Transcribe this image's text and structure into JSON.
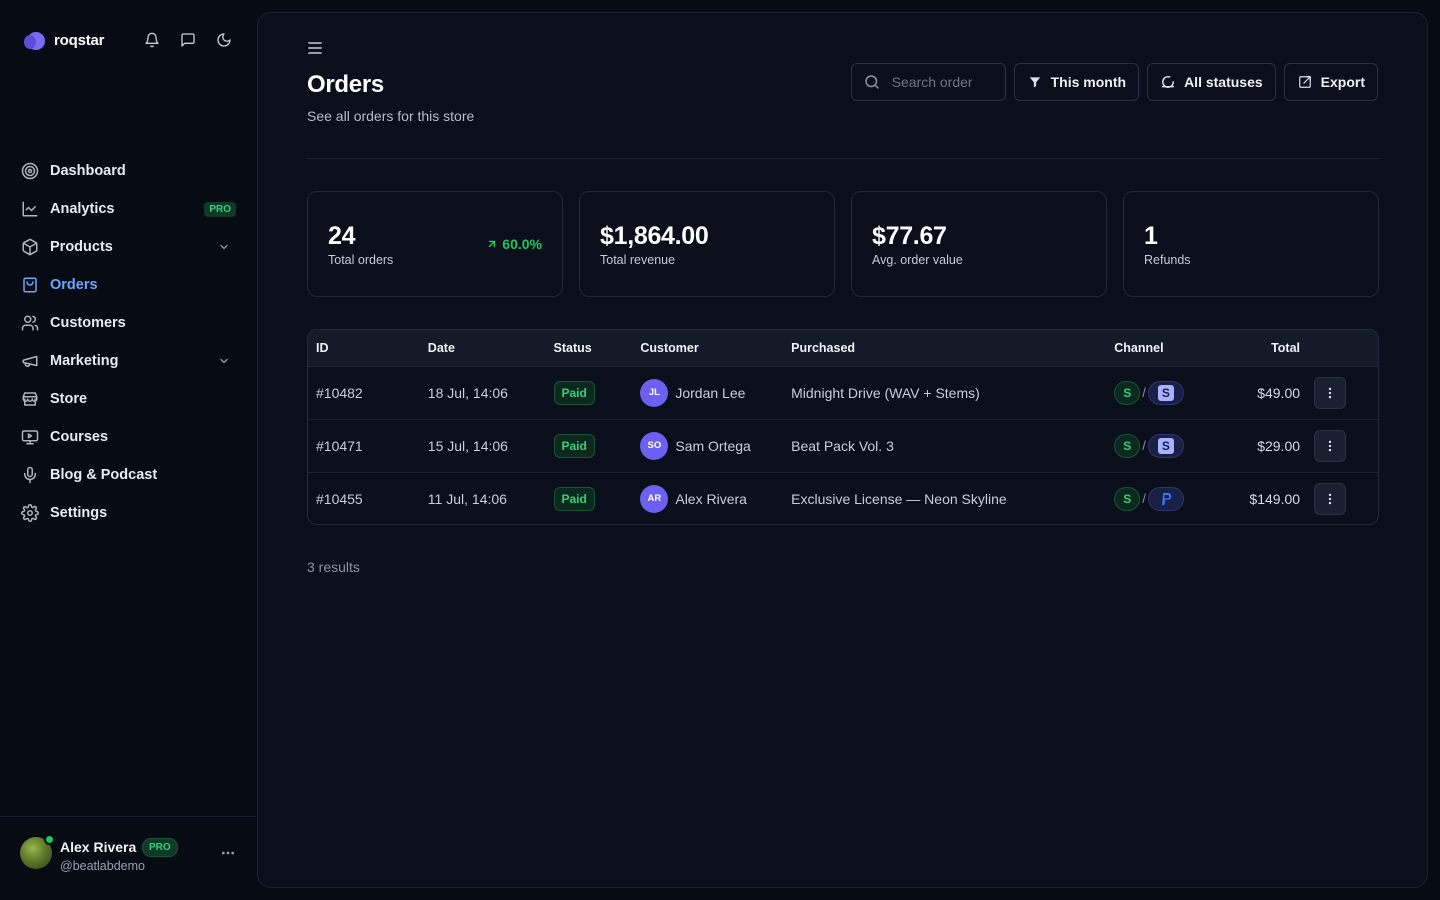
{
  "brand": {
    "name": "roqstar"
  },
  "top_icons": [
    "bell-icon",
    "chat-icon",
    "moon-icon"
  ],
  "sidebar": {
    "items": [
      {
        "label": "Dashboard",
        "icon": "target-icon"
      },
      {
        "label": "Analytics",
        "icon": "chart-line-icon",
        "badge": "PRO"
      },
      {
        "label": "Products",
        "icon": "box-icon",
        "expandable": true
      },
      {
        "label": "Orders",
        "icon": "bag-icon",
        "active": true
      },
      {
        "label": "Customers",
        "icon": "users-icon"
      },
      {
        "label": "Marketing",
        "icon": "megaphone-icon",
        "expandable": true
      },
      {
        "label": "Store",
        "icon": "store-icon"
      },
      {
        "label": "Courses",
        "icon": "presentation-icon"
      },
      {
        "label": "Blog & Podcast",
        "icon": "microphone-icon"
      },
      {
        "label": "Settings",
        "icon": "gear-icon"
      }
    ]
  },
  "user": {
    "name": "Alex Rivera",
    "badge": "PRO",
    "handle": "@beatlabdemo"
  },
  "header": {
    "title": "Orders",
    "subtitle": "See all orders for this store"
  },
  "toolbar": {
    "search_placeholder": "Search order",
    "period_label": "This month",
    "status_label": "All statuses",
    "export_label": "Export"
  },
  "stats": [
    {
      "value": "24",
      "label": "Total orders",
      "delta": "60.0%"
    },
    {
      "value": "$1,864.00",
      "label": "Total revenue"
    },
    {
      "value": "$77.67",
      "label": "Avg. order value"
    },
    {
      "value": "1",
      "label": "Refunds"
    }
  ],
  "table": {
    "columns": [
      "ID",
      "Date",
      "Status",
      "Customer",
      "Purchased",
      "Channel",
      "Total"
    ],
    "rows": [
      {
        "id": "#10482",
        "date": "18 Jul, 14:06",
        "status": "Paid",
        "initials": "JL",
        "customer": "Jordan Lee",
        "purchased": "Midnight Drive (WAV + Stems)",
        "channel_a": "S",
        "channel_b": "stripe",
        "channel_b_label": "S",
        "total": "$49.00"
      },
      {
        "id": "#10471",
        "date": "15 Jul, 14:06",
        "status": "Paid",
        "initials": "SO",
        "customer": "Sam Ortega",
        "purchased": "Beat Pack Vol. 3",
        "channel_a": "S",
        "channel_b": "stripe",
        "channel_b_label": "S",
        "total": "$29.00"
      },
      {
        "id": "#10455",
        "date": "11 Jul, 14:06",
        "status": "Paid",
        "initials": "AR",
        "customer": "Alex Rivera",
        "purchased": "Exclusive License — Neon Skyline",
        "channel_a": "S",
        "channel_b": "paypal",
        "channel_b_label": "",
        "total": "$149.00"
      }
    ]
  },
  "results_text": "3 results",
  "colors": {
    "accent": "#6aa7ff",
    "success": "#22c55e",
    "avatar": "#6d5ff0",
    "background": "#070b14"
  }
}
